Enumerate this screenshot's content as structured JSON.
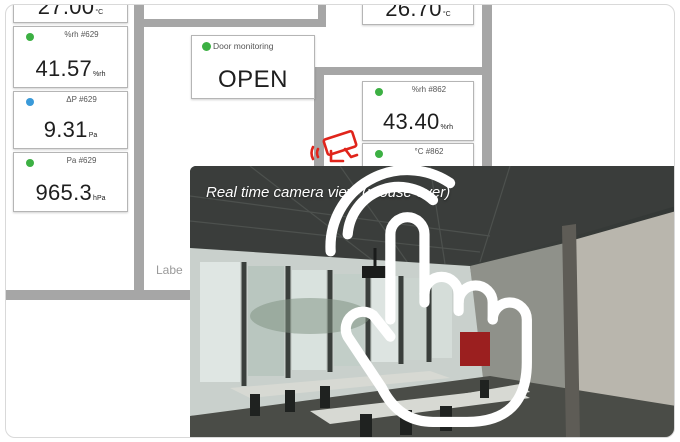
{
  "video": {
    "caption": "Real time camera view (mouse over)"
  },
  "door": {
    "label": "Door monitoring",
    "value": "OPEN",
    "status_color": "#3cb043"
  },
  "plan": {
    "room_label": "Labe"
  },
  "sensors": [
    {
      "label": "",
      "value": "27.00",
      "unit": "°C",
      "status_color": "#3cb043"
    },
    {
      "label": "%rh #629",
      "value": "41.57",
      "unit": "%rh",
      "status_color": "#3cb043"
    },
    {
      "label": "ΔP #629",
      "value": "9.31",
      "unit": "Pa",
      "status_color": "#3a9ad9"
    },
    {
      "label": "Pa #629",
      "value": "965.3",
      "unit": "hPa",
      "status_color": "#3cb043"
    },
    {
      "label": "",
      "value": "26.70",
      "unit": "°C",
      "status_color": "#3cb043"
    },
    {
      "label": "%rh #862",
      "value": "43.40",
      "unit": "%rh",
      "status_color": "#3cb043"
    },
    {
      "label": "°C #862",
      "value": "",
      "unit": "",
      "status_color": "#3cb043"
    }
  ],
  "icons": {
    "camera": "security-camera-icon",
    "hand": "touch-hand-icon"
  },
  "colors": {
    "camera_icon": "#e0241b",
    "wall": "#a6a6a6"
  }
}
